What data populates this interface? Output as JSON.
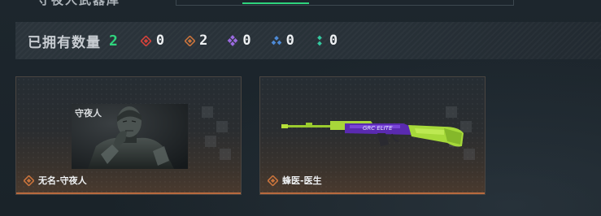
{
  "top_strip": {
    "cut_text": "守夜人武器库"
  },
  "stats": {
    "owned_label": "已拥有数量",
    "owned_count": "2",
    "rarities": [
      {
        "icon": "red-diamond-icon",
        "color": "#d4423b",
        "value": "0"
      },
      {
        "icon": "orange-diamond-icon",
        "color": "#c8733c",
        "value": "2"
      },
      {
        "icon": "purple-cluster-icon",
        "color": "#9b6ae0",
        "value": "0"
      },
      {
        "icon": "blue-cluster-icon",
        "color": "#4d8ad6",
        "value": "0"
      },
      {
        "icon": "green-dots-icon",
        "color": "#34c9a0",
        "value": "0"
      }
    ]
  },
  "cards": [
    {
      "name": "无名-守夜人",
      "image_logo": "守夜人",
      "rarity_icon": "orange-diamond-icon",
      "rarity_color": "#c8733c"
    },
    {
      "name": "蜂医-医生",
      "image_logo": "GRC ELITE",
      "rarity_icon": "orange-diamond-icon",
      "rarity_color": "#c8733c"
    }
  ],
  "colors": {
    "accent_green": "#2fd47d",
    "card_bottom_bar": "#b96a3e"
  }
}
